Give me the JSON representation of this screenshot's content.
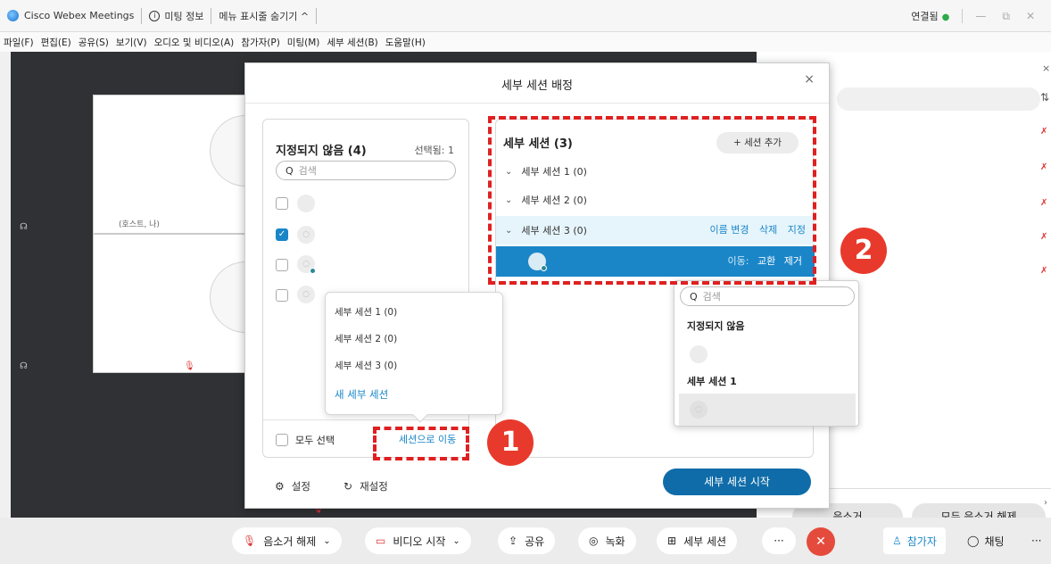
{
  "titlebar": {
    "app_name": "Cisco Webex Meetings",
    "meeting_info": "미팅 정보",
    "hide_menu": "메뉴 표시줄 숨기기 ^",
    "connection": "연결됨",
    "connection_dot": "●",
    "minimize": "—",
    "maximize": "⧉",
    "close": "✕"
  },
  "menubar": {
    "items": [
      "파일(F)",
      "편집(E)",
      "공유(S)",
      "보기(V)",
      "오디오 및 비디오(A)",
      "참가자(P)",
      "미팅(M)",
      "세부 세션(B)",
      "도움말(H)"
    ]
  },
  "stage": {
    "tile_label": "(호스트, 나)"
  },
  "modal": {
    "title": "세부 세션 배정",
    "close": "×",
    "unassigned": {
      "title": "지정되지 않음 (4)",
      "selected": "선택됨: 1",
      "search_placeholder": "검색",
      "select_all": "모두 선택",
      "move_to_session": "세션으로 이동"
    },
    "sessions": {
      "title": "세부 세션 (3)",
      "add_button": "+ 세션 추가",
      "items": [
        {
          "label": "세부 세션 1 (0)"
        },
        {
          "label": "세부 세션 2 (0)"
        },
        {
          "label": "세부 세션 3 (0)"
        }
      ],
      "row_actions": {
        "rename": "이름 변경",
        "delete": "삭제",
        "assign": "지정"
      },
      "member_actions": {
        "move_label": "이동:",
        "swap": "교환",
        "remove": "제거"
      }
    },
    "settings": "설정",
    "reset": "재설정",
    "start_button": "세부 세션 시작"
  },
  "move_dropdown": {
    "items": [
      "세부 세션 1 (0)",
      "세부 세션 2 (0)",
      "세부 세션 3 (0)"
    ],
    "new_session": "새 세부 세션"
  },
  "swap_popover": {
    "search_placeholder": "검색",
    "group1": "지정되지 않음",
    "group2": "세부 세션 1"
  },
  "annotations": {
    "badge1": "1",
    "badge2": "2",
    "color": "#e02020"
  },
  "right_panel": {
    "mute_label": "음소거",
    "unmute_all": "모두 음소거 해제"
  },
  "toolbar": {
    "unmute": "음소거 해제",
    "video": "비디오 시작",
    "share": "공유",
    "record": "녹화",
    "breakout": "세부 세션",
    "more": "···",
    "end": "✕",
    "participants": "참가자",
    "chat": "채팅",
    "more2": "···"
  },
  "colors": {
    "accent": "#1a86c8",
    "start_button": "#0f6ca8",
    "end_button": "#e54b3c",
    "annotation": "#e02020"
  }
}
